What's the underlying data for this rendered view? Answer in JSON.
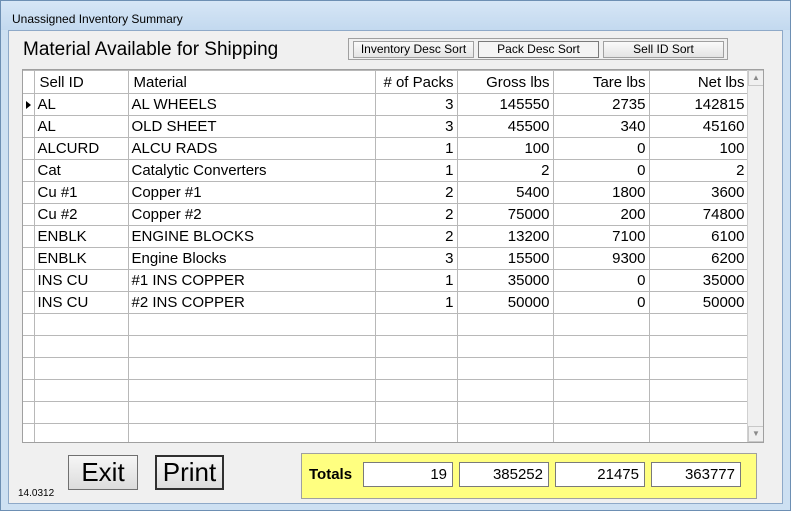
{
  "window": {
    "title": "Unassigned Inventory Summary"
  },
  "heading": "Material Available for Shipping",
  "sort_buttons": [
    "Inventory Desc Sort",
    "Pack Desc Sort",
    "Sell ID Sort"
  ],
  "active_sort": "Pack Desc Sort",
  "table": {
    "columns": [
      "Sell ID",
      "Material",
      "# of Packs",
      "Gross lbs",
      "Tare lbs",
      "Net lbs"
    ],
    "rows": [
      [
        "AL",
        "AL WHEELS",
        "3",
        "145550",
        "2735",
        "142815"
      ],
      [
        "AL",
        "OLD SHEET",
        "3",
        "45500",
        "340",
        "45160"
      ],
      [
        "ALCURD",
        "ALCU RADS",
        "1",
        "100",
        "0",
        "100"
      ],
      [
        "Cat",
        "Catalytic Converters",
        "1",
        "2",
        "0",
        "2"
      ],
      [
        "Cu #1",
        "Copper #1",
        "2",
        "5400",
        "1800",
        "3600"
      ],
      [
        "Cu #2",
        "Copper #2",
        "2",
        "75000",
        "200",
        "74800"
      ],
      [
        "ENBLK",
        "ENGINE BLOCKS",
        "2",
        "13200",
        "7100",
        "6100"
      ],
      [
        "ENBLK",
        "Engine Blocks",
        "3",
        "15500",
        "9300",
        "6200"
      ],
      [
        "INS CU",
        "#1 INS COPPER",
        "1",
        "35000",
        "0",
        "35000"
      ],
      [
        "INS CU",
        "#2 INS COPPER",
        "1",
        "50000",
        "0",
        "50000"
      ]
    ],
    "empty_rows": 6,
    "selected_row": 0
  },
  "buttons": {
    "exit": "Exit",
    "print": "Print"
  },
  "totals": {
    "label": "Totals",
    "packs": "19",
    "gross": "385252",
    "tare": "21475",
    "net": "363777"
  },
  "version": "14.0312",
  "icons": {
    "scroll_up": "scroll-up-arrow-icon",
    "scroll_down": "scroll-down-arrow-icon",
    "row_pointer": "row-pointer-icon"
  },
  "colors": {
    "totals_background": "#ffff80",
    "client_background": "#f0f0f0",
    "frame": "#cde0f2"
  }
}
